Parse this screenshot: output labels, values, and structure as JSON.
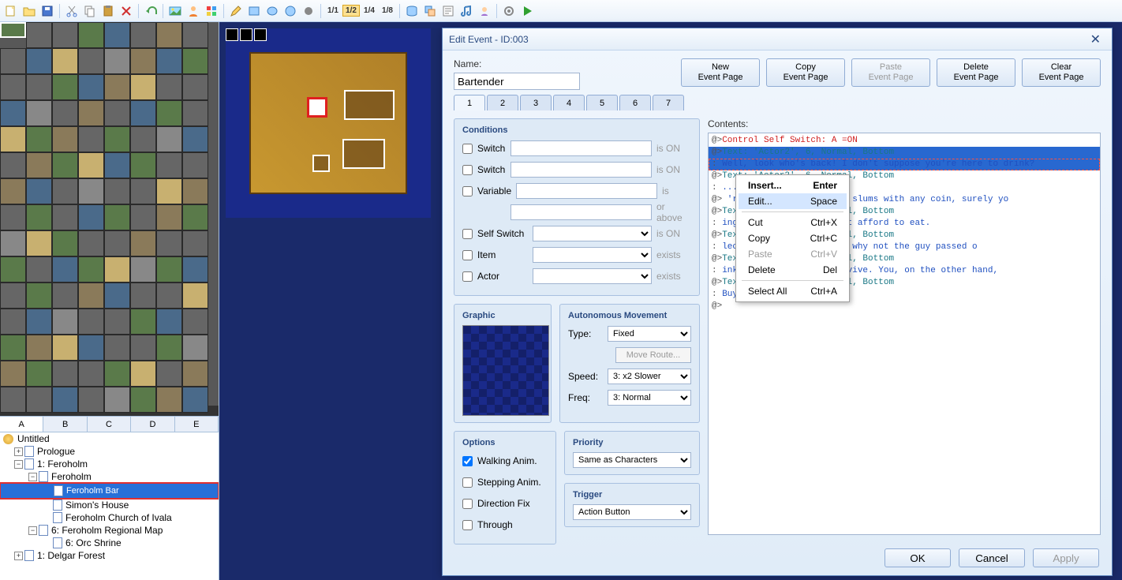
{
  "toolbar": {
    "fractions": [
      "1/1",
      "1/2",
      "1/4",
      "1/8"
    ],
    "active_fraction": "1/2"
  },
  "palette_tabs": [
    "A",
    "B",
    "C",
    "D",
    "E"
  ],
  "active_palette_tab": "A",
  "tree": {
    "root": "Untitled",
    "items": [
      {
        "exp": "+",
        "indent": 0,
        "label": "Prologue"
      },
      {
        "exp": "−",
        "indent": 0,
        "label": "1: Feroholm"
      },
      {
        "exp": "−",
        "indent": 1,
        "label": "Feroholm"
      },
      {
        "exp": "",
        "indent": 2,
        "label": "Feroholm Bar",
        "selected": true
      },
      {
        "exp": "",
        "indent": 2,
        "label": "Simon's House"
      },
      {
        "exp": "",
        "indent": 2,
        "label": "Feroholm Church of Ivala"
      },
      {
        "exp": "−",
        "indent": 1,
        "label": "6: Feroholm Regional Map"
      },
      {
        "exp": "",
        "indent": 2,
        "label": "6: Orc Shrine"
      },
      {
        "exp": "+",
        "indent": 0,
        "label": "1: Delgar Forest"
      }
    ]
  },
  "dialog": {
    "title": "Edit Event - ID:003",
    "name_label": "Name:",
    "name_value": "Bartender",
    "buttons": {
      "new": "New\nEvent Page",
      "copy": "Copy\nEvent Page",
      "paste": "Paste\nEvent Page",
      "delete": "Delete\nEvent Page",
      "clear": "Clear\nEvent Page"
    },
    "tabs": [
      "1",
      "2",
      "3",
      "4",
      "5",
      "6",
      "7"
    ],
    "active_tab": "1",
    "conditions": {
      "title": "Conditions",
      "switch1": "Switch",
      "switch1_st": "is ON",
      "switch2": "Switch",
      "switch2_st": "is ON",
      "variable": "Variable",
      "variable_st": "is",
      "orabove": "or above",
      "selfswitch": "Self Switch",
      "selfswitch_st": "is ON",
      "item": "Item",
      "item_st": "exists",
      "actor": "Actor",
      "actor_st": "exists"
    },
    "graphic": {
      "title": "Graphic"
    },
    "movement": {
      "title": "Autonomous Movement",
      "type_label": "Type:",
      "type_value": "Fixed",
      "route_btn": "Move Route...",
      "speed_label": "Speed:",
      "speed_value": "3: x2 Slower",
      "freq_label": "Freq:",
      "freq_value": "3: Normal"
    },
    "options": {
      "title": "Options",
      "walking": "Walking Anim.",
      "stepping": "Stepping Anim.",
      "dirfix": "Direction Fix",
      "through": "Through"
    },
    "priority": {
      "title": "Priority",
      "value": "Same as Characters"
    },
    "trigger": {
      "title": "Trigger",
      "value": "Action Button"
    },
    "contents_label": "Contents:",
    "contents": [
      {
        "prefix": "@>",
        "cls": "red",
        "text": "Control Self Switch: A =ON"
      },
      {
        "prefix": "@>",
        "cls": "teal sel",
        "text": "Text: 'Actor2', 6, Normal, Bottom"
      },
      {
        "prefix": " : ",
        "cls": "blue sel dashed",
        "text": "    Well, look who's back! I don't suppose you're here to drink?"
      },
      {
        "prefix": "@>",
        "cls": "teal",
        "text": "Text: 'Actor2', 6, Normal, Bottom"
      },
      {
        "prefix": " : ",
        "cls": "blue",
        "text": "    ...                                          Bottom"
      },
      {
        "prefix": "@>",
        "cls": "blue",
        "text": "    're the only one in the slums with any coin, surely yo"
      },
      {
        "prefix": "@>",
        "cls": "teal",
        "text": "Text: 'Actor2', 6, Normal, Bottom"
      },
      {
        "prefix": " : ",
        "cls": "blue",
        "text": "    ing when some of us can't afford to eat."
      },
      {
        "prefix": "@>",
        "cls": "teal",
        "text": "Text: 'Actor2', 6, Normal, Bottom"
      },
      {
        "prefix": " : ",
        "cls": "blue",
        "text": "    lecture someone so much, why not the guy passed o"
      },
      {
        "prefix": "@>",
        "cls": "teal",
        "text": "Text: 'Actor2', 6, Normal, Bottom"
      },
      {
        "prefix": " : ",
        "cls": "blue",
        "text": "    inks he has to do to survive. You, on the other hand,"
      },
      {
        "prefix": "@>",
        "cls": "teal",
        "text": "Text: 'Actor2', 6, Normal, Bottom"
      },
      {
        "prefix": " : ",
        "cls": "blue",
        "text": "    Buy a drink or get out!"
      },
      {
        "prefix": "@>",
        "cls": "",
        "text": ""
      }
    ],
    "footer": {
      "ok": "OK",
      "cancel": "Cancel",
      "apply": "Apply"
    }
  },
  "context_menu": [
    {
      "label": "Insert...",
      "accel": "Enter",
      "bold": true
    },
    {
      "label": "Edit...",
      "accel": "Space",
      "hl": true
    },
    {
      "sep": true
    },
    {
      "label": "Cut",
      "accel": "Ctrl+X"
    },
    {
      "label": "Copy",
      "accel": "Ctrl+C"
    },
    {
      "label": "Paste",
      "accel": "Ctrl+V",
      "dis": true
    },
    {
      "label": "Delete",
      "accel": "Del"
    },
    {
      "sep": true
    },
    {
      "label": "Select All",
      "accel": "Ctrl+A"
    }
  ]
}
